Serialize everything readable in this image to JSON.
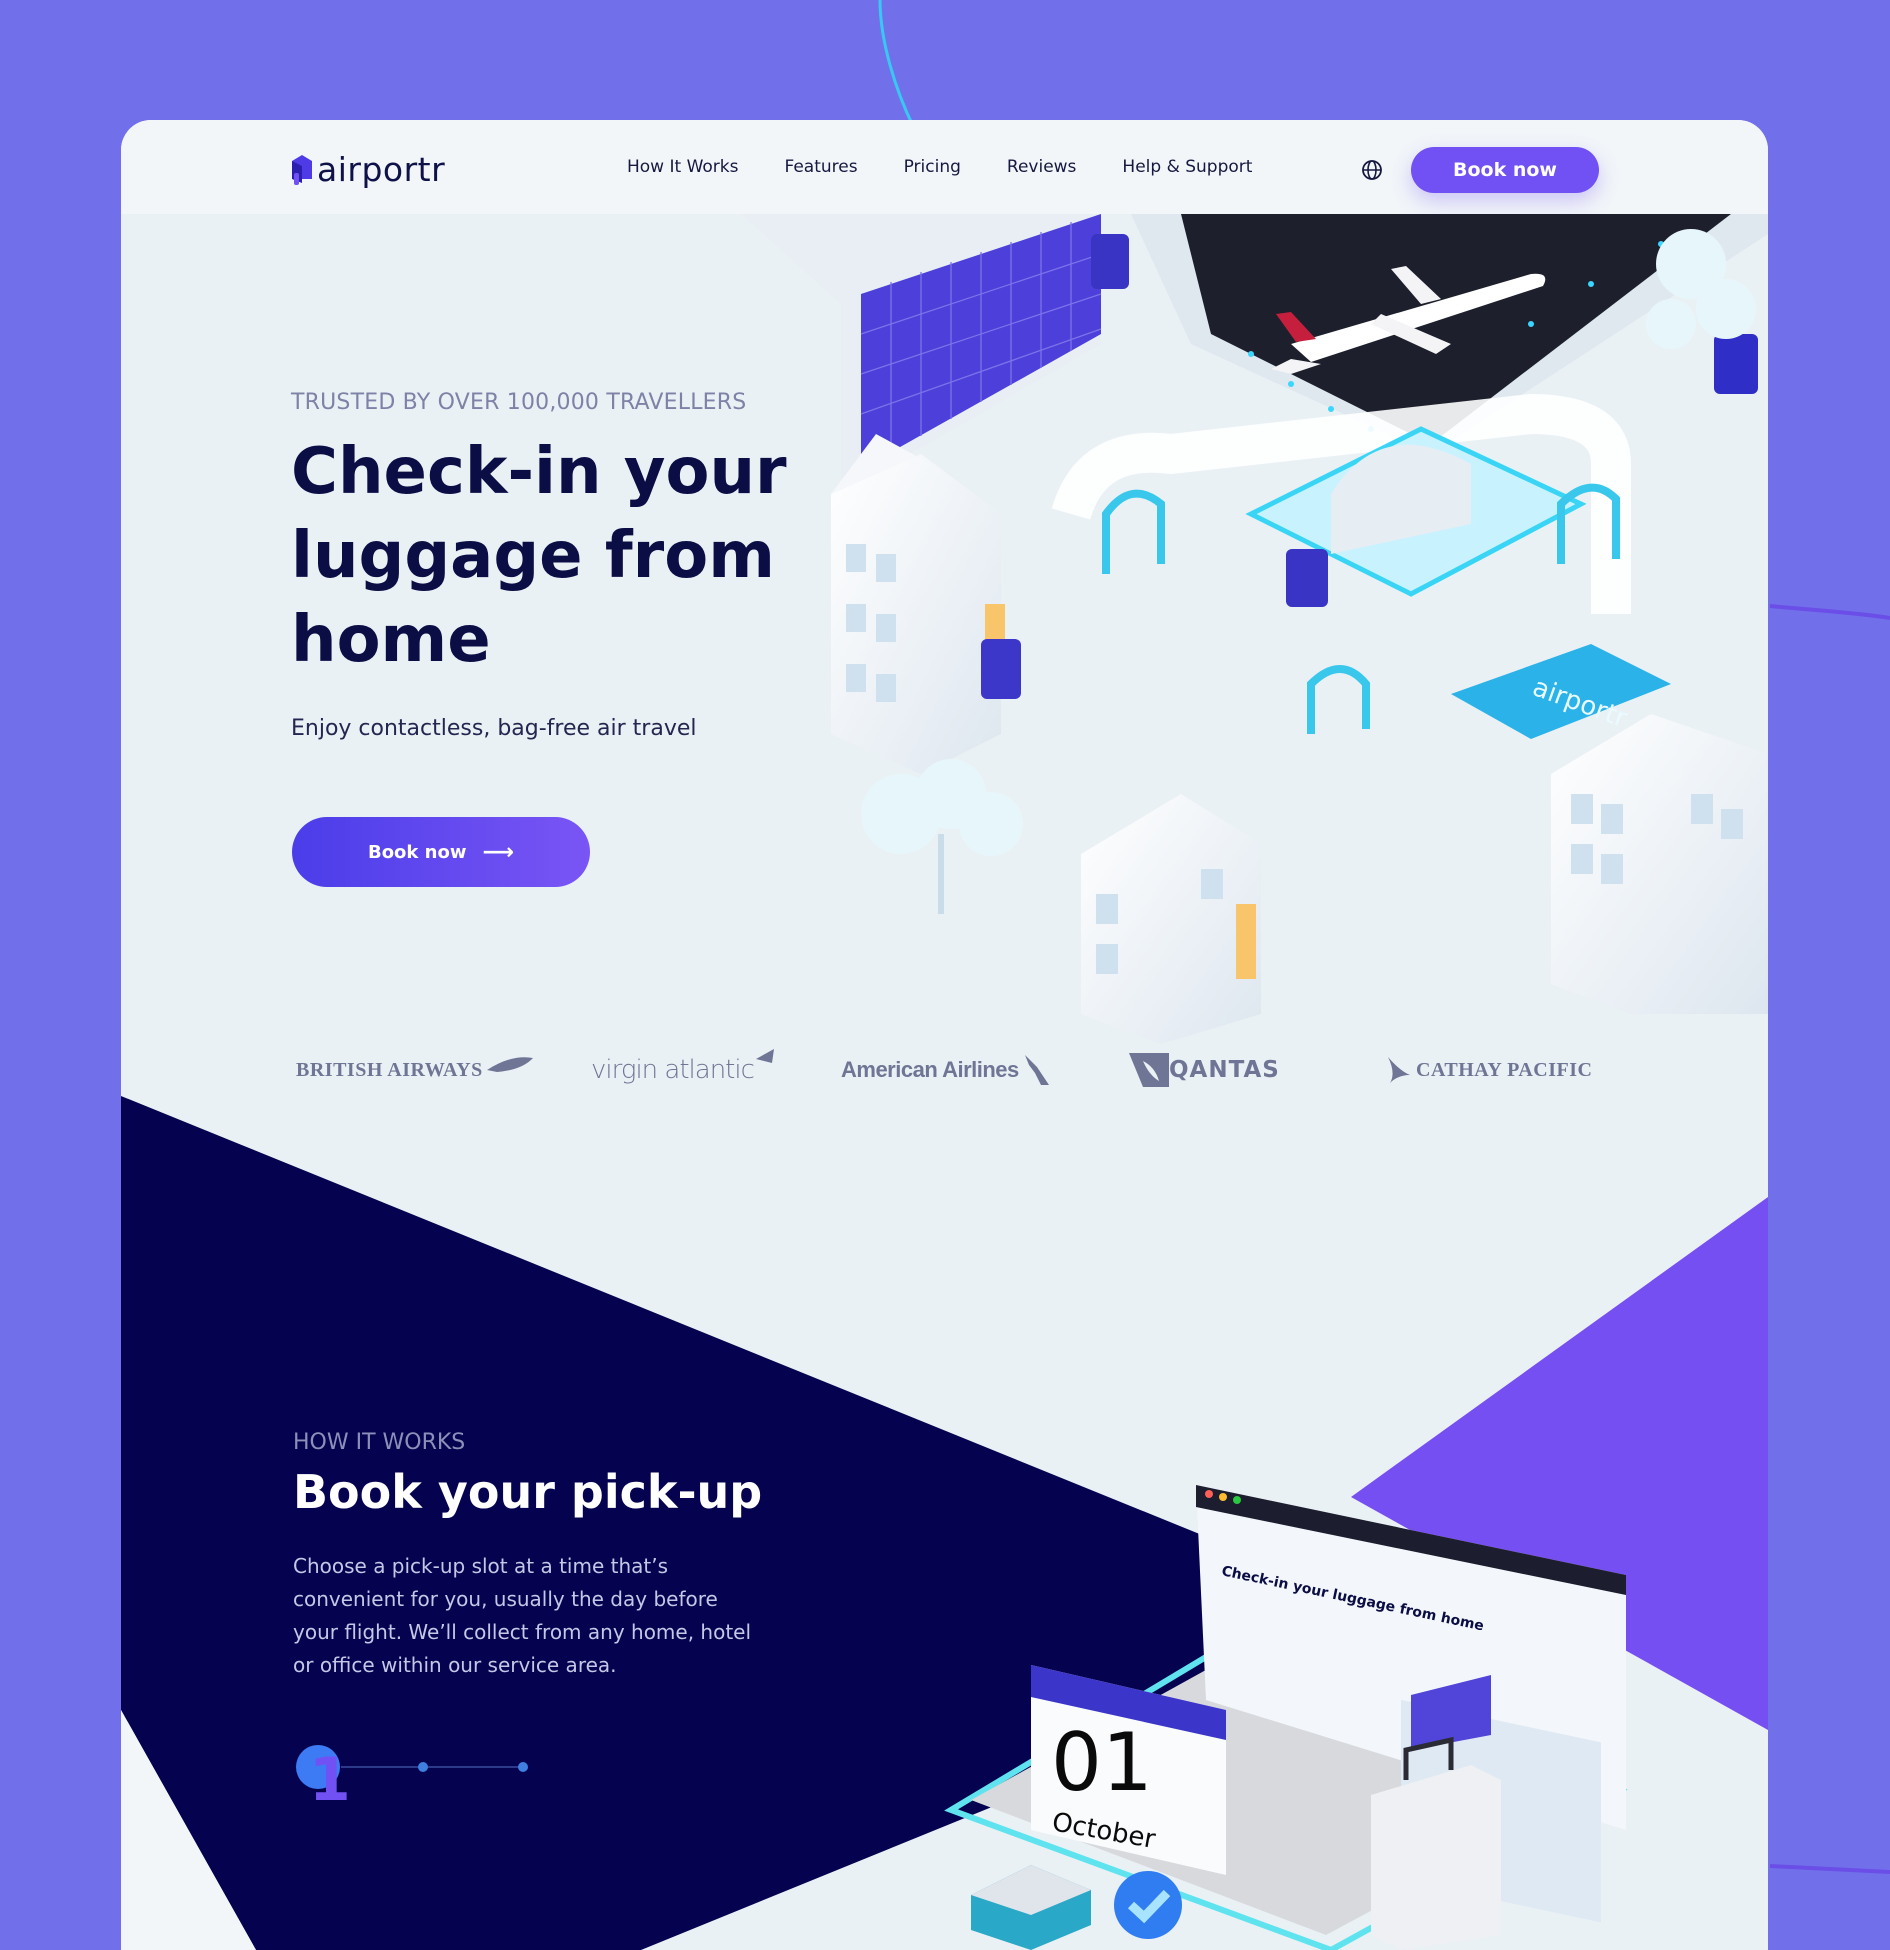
{
  "brand": {
    "name": "airportr",
    "accent": "#7151f3",
    "dark": "#05034f",
    "purple_panel": "#764ff2"
  },
  "nav": {
    "items": [
      "How It Works",
      "Features",
      "Pricing",
      "Reviews",
      "Help & Support"
    ],
    "language_icon": "globe-icon",
    "book_label": "Book now"
  },
  "hero": {
    "tagline": "TRUSTED BY OVER 100,000 TRAVELLERS",
    "title": "Check-in your luggage from home",
    "subtitle": "Enjoy contactless, bag-free air travel",
    "cta_label": "Book now",
    "cta_icon": "arrow-right-icon",
    "illustration_sign": "airportr"
  },
  "airlines": [
    "BRITISH AIRWAYS",
    "virgin atlantic",
    "American Airlines",
    "QANTAS",
    "CATHAY PACIFIC"
  ],
  "how_it_works": {
    "tag": "HOW IT WORKS",
    "title": "Book your pick-up",
    "body": "Choose a pick-up slot at a time that’s convenient for you, usually the day before your flight. We’ll collect from any home, hotel or office within our service area.",
    "step_number": "1",
    "steps_total": 3,
    "active_step": 1,
    "calendar": {
      "day": "01",
      "month": "October"
    },
    "screen_title": "Check-in your luggage from home"
  }
}
